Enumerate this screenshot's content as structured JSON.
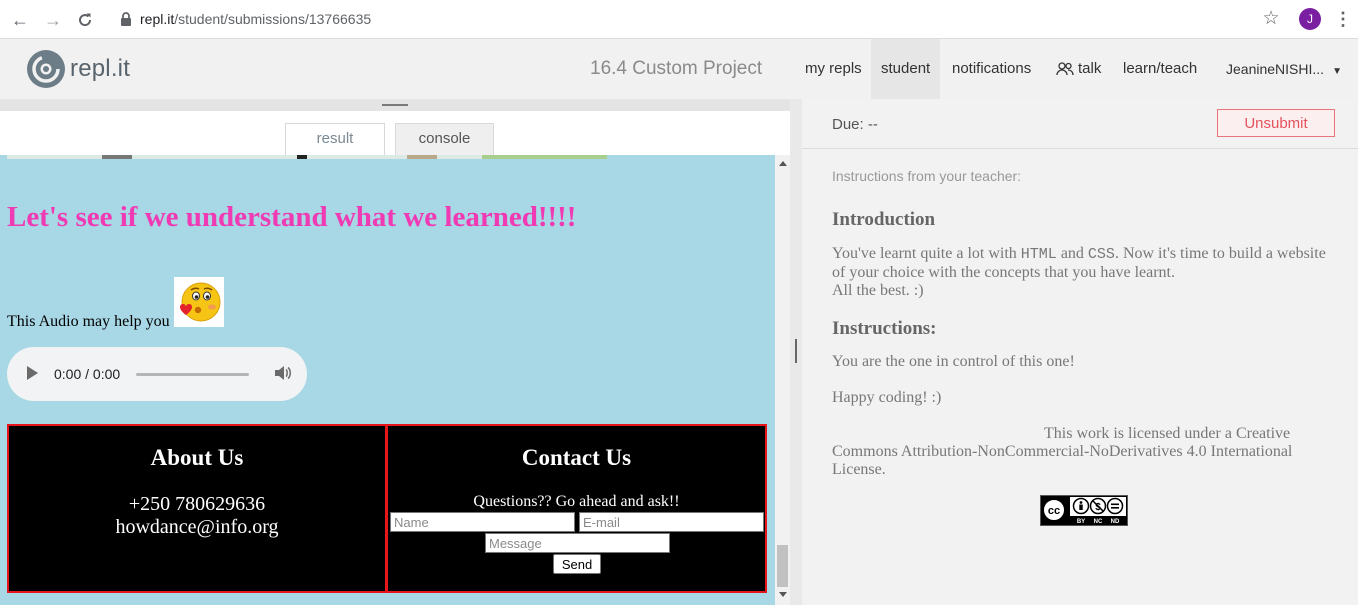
{
  "browser": {
    "url_host": "repl.it",
    "url_path": "/student/submissions/13766635",
    "profile_initial": "J"
  },
  "header": {
    "logo_text": "repl.it",
    "project_title": "16.4 Custom Project",
    "nav": {
      "my_repls": "my repls",
      "student": "student",
      "notifications": "notifications",
      "talk": "talk",
      "learn_teach": "learn/teach",
      "user": "JeanineNISHI..."
    }
  },
  "tabs": {
    "result": "result",
    "console": "console"
  },
  "preview": {
    "heading": "Let's see if we understand what we learned!!!!",
    "audio_text": "This Audio may help you",
    "audio_time": "0:00 / 0:00",
    "about": {
      "title": "About Us",
      "phone": "+250 780629636",
      "email": "howdance@info.org"
    },
    "contact": {
      "title": "Contact Us",
      "question": "Questions?? Go ahead and ask!!",
      "name_placeholder": "Name",
      "email_placeholder": "E-mail",
      "message_placeholder": "Message",
      "send_label": "Send"
    }
  },
  "instructions": {
    "due": "Due: --",
    "unsubmit_label": "Unsubmit",
    "from_teacher": "Instructions from your teacher:",
    "intro_heading": "Introduction",
    "intro_p1_a": "You've learnt quite a lot with ",
    "intro_html": "HTML",
    "intro_and": " and ",
    "intro_css": "CSS",
    "intro_p1_b": ". Now it's time to build a website of your choice with the concepts that you have learnt.",
    "intro_p2": "All the best. :)",
    "instructions_heading": "Instructions:",
    "control_text": "You are the one in control of this one!",
    "happy_text": "Happy coding! :)",
    "license_text": "This work is licensed under a  Creative Commons Attribution-NonCommercial-NoDerivatives 4.0 International License.",
    "cc_labels": [
      "BY",
      "NC",
      "ND"
    ]
  },
  "colors": {
    "preview_bg": "#a8d7e5",
    "heading_pink": "#ef3ab4",
    "footer_border": "#e6161b",
    "unsubmit_red": "#e5535d",
    "avatar_purple": "#7b1fa2"
  }
}
